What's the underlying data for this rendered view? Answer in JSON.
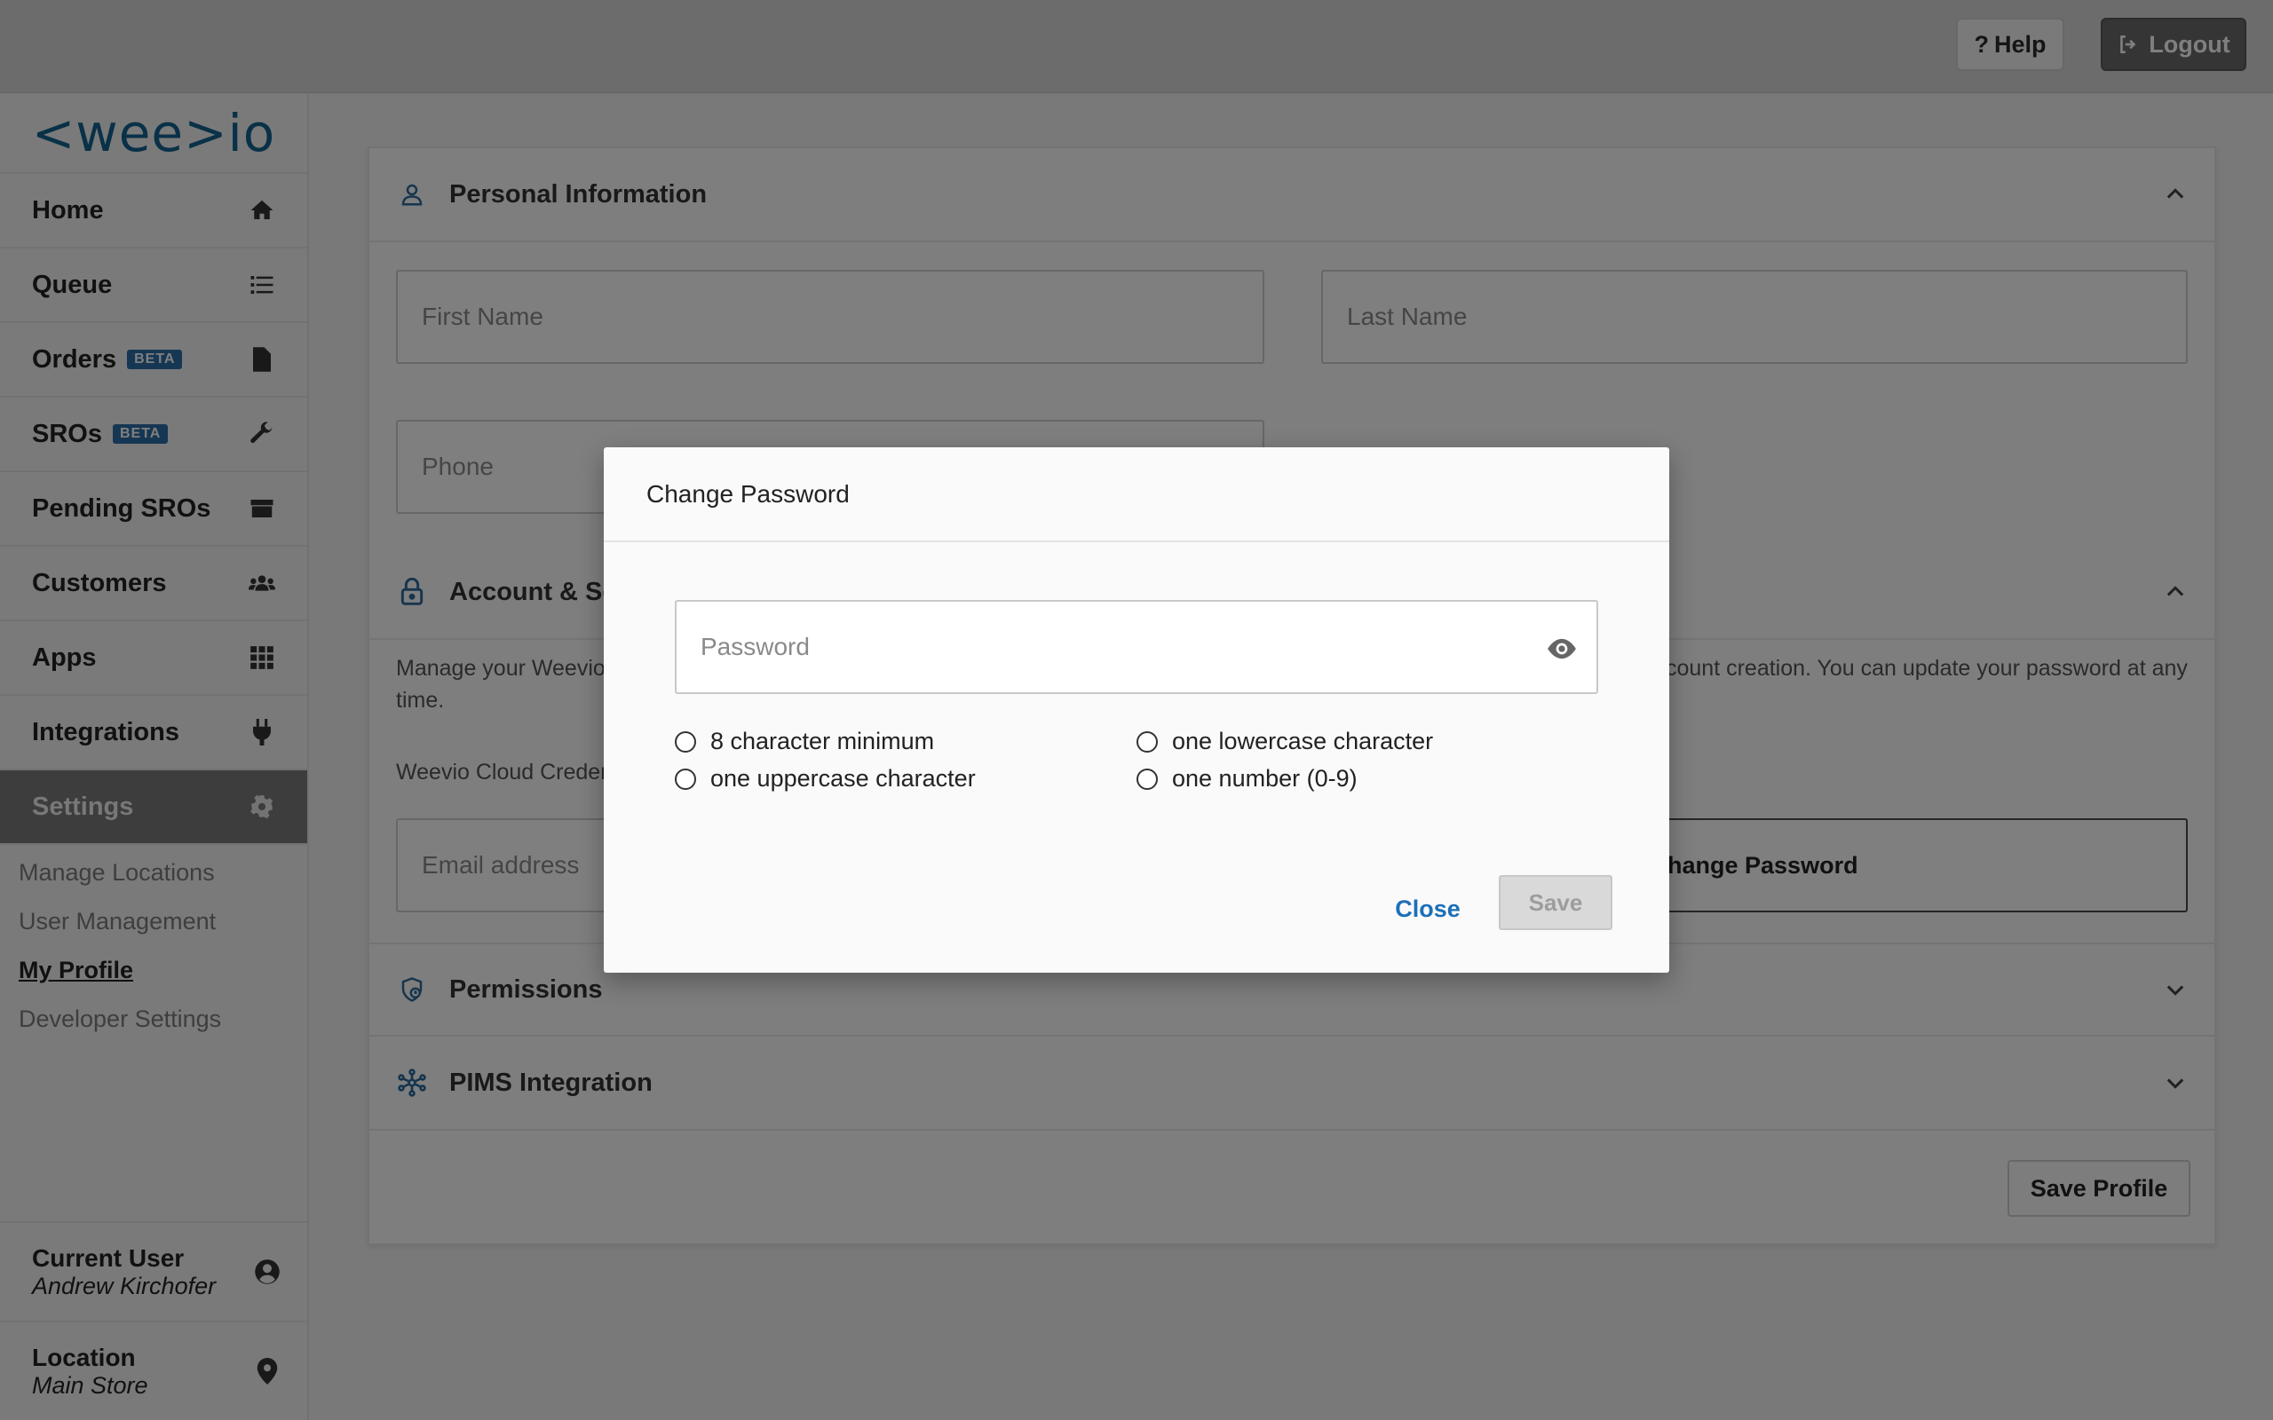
{
  "topbar": {
    "help_label": "Help",
    "logout_label": "Logout"
  },
  "sidebar": {
    "logo_text": "<wee>io",
    "items": [
      {
        "label": "Home",
        "icon": "home-icon"
      },
      {
        "label": "Queue",
        "icon": "list-icon"
      },
      {
        "label": "Orders",
        "badge": "BETA",
        "icon": "file-icon"
      },
      {
        "label": "SROs",
        "badge": "BETA",
        "icon": "wrench-icon"
      },
      {
        "label": "Pending SROs",
        "icon": "box-icon"
      },
      {
        "label": "Customers",
        "icon": "users-icon"
      },
      {
        "label": "Apps",
        "icon": "grid-icon"
      },
      {
        "label": "Integrations",
        "icon": "plug-icon"
      },
      {
        "label": "Settings",
        "icon": "gear-icon"
      }
    ],
    "subitems": [
      "Manage Locations",
      "User Management",
      "My Profile",
      "Developer Settings"
    ],
    "current_user": {
      "title": "Current User",
      "name": "Andrew Kirchofer"
    },
    "location": {
      "title": "Location",
      "name": "Main Store"
    }
  },
  "main": {
    "personal": {
      "title": "Personal Information",
      "first_name_placeholder": "First Name",
      "last_name_placeholder": "Last Name",
      "phone_placeholder": "Phone"
    },
    "account": {
      "title": "Account & Se",
      "desc_left_1": "Manage your Weevio",
      "desc_left_2": "time.",
      "desc_right": "count creation. You can update your password at any",
      "credentials_label": "Weevio Cloud Creden",
      "email_placeholder": "Email address",
      "change_password_label": "hange Password"
    },
    "permissions_title": "Permissions",
    "pims_title": "PIMS Integration",
    "save_profile_label": "Save Profile"
  },
  "modal": {
    "title": "Change Password",
    "password_placeholder": "Password",
    "requirements": [
      "8 character minimum",
      "one lowercase character",
      "one uppercase character",
      "one number (0-9)"
    ],
    "close_label": "Close",
    "save_label": "Save"
  }
}
